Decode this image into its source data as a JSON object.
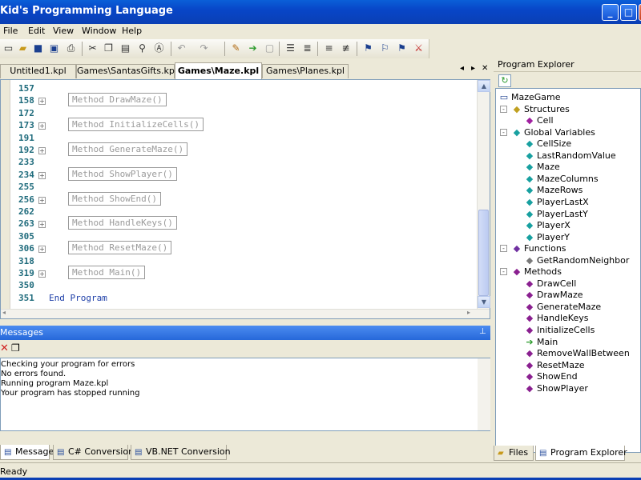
{
  "window": {
    "title": "Kid's Programming Language",
    "controls": [
      "_",
      "□",
      "✕"
    ]
  },
  "menu": [
    "File",
    "Edit",
    "View",
    "Window",
    "Help"
  ],
  "toolbar": {
    "icons": [
      "new-icon",
      "open-icon",
      "save-icon",
      "save-all-icon",
      "print-icon",
      "cut-icon",
      "copy-icon",
      "paste-icon",
      "find-icon",
      "replace-icon",
      "undo-icon",
      "redo-icon",
      "check-icon",
      "run-icon",
      "stop-icon",
      "indent-icon",
      "outdent-icon",
      "comment-icon",
      "uncomment-icon",
      "bookmark-icon",
      "bookmark-next-icon",
      "bookmark-clear-icon"
    ]
  },
  "editor_tabs": [
    "Untitled1.kpl",
    "Games\\SantasGifts.kpl",
    "Games\\Maze.kpl",
    "Games\\Planes.kpl"
  ],
  "editor_tab_nav": {
    "prev": "◂",
    "next": "▸",
    "close": "✕"
  },
  "code": [
    {
      "ln": "157",
      "text": ""
    },
    {
      "ln": "158",
      "text": "Method DrawMaze()"
    },
    {
      "ln": "172",
      "text": ""
    },
    {
      "ln": "173",
      "text": "Method InitializeCells()"
    },
    {
      "ln": "191",
      "text": ""
    },
    {
      "ln": "192",
      "text": "Method GenerateMaze()"
    },
    {
      "ln": "233",
      "text": ""
    },
    {
      "ln": "234",
      "text": "Method ShowPlayer()"
    },
    {
      "ln": "255",
      "text": ""
    },
    {
      "ln": "256",
      "text": "Method ShowEnd()"
    },
    {
      "ln": "262",
      "text": ""
    },
    {
      "ln": "263",
      "text": "Method HandleKeys()"
    },
    {
      "ln": "305",
      "text": ""
    },
    {
      "ln": "306",
      "text": "Method ResetMaze()"
    },
    {
      "ln": "318",
      "text": ""
    },
    {
      "ln": "319",
      "text": "Method Main()"
    },
    {
      "ln": "350",
      "text": ""
    },
    {
      "ln": "351",
      "text": "End Program"
    }
  ],
  "messages": {
    "title": "Messages",
    "lines": [
      "Checking your program for errors",
      "No errors found.",
      "Running program Maze.kpl",
      "Your program has stopped running"
    ]
  },
  "bottom_tabs": [
    "Messages",
    "C# Conversion",
    "VB.NET Conversion"
  ],
  "status": "Ready",
  "explorer": {
    "title": "Program Explorer",
    "root": "MazeGame",
    "structures": {
      "label": "Structures",
      "items": [
        "Cell"
      ]
    },
    "globals": {
      "label": "Global Variables",
      "items": [
        "CellSize",
        "LastRandomValue",
        "Maze",
        "MazeColumns",
        "MazeRows",
        "PlayerLastX",
        "PlayerLastY",
        "PlayerX",
        "PlayerY"
      ]
    },
    "functions": {
      "label": "Functions",
      "items": [
        "GetRandomNeighbor"
      ]
    },
    "methods": {
      "label": "Methods",
      "items": [
        "DrawCell",
        "DrawMaze",
        "GenerateMaze",
        "HandleKeys",
        "InitializeCells",
        "Main",
        "RemoveWallBetween",
        "ResetMaze",
        "ShowEnd",
        "ShowPlayer"
      ]
    },
    "tabs": [
      "Files",
      "Program Explorer"
    ]
  }
}
